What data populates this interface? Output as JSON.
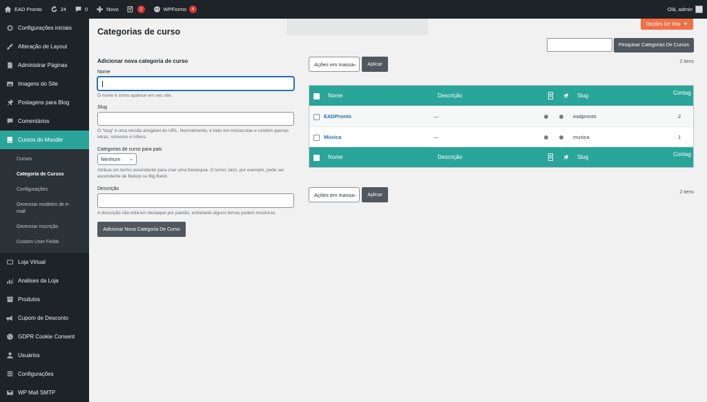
{
  "adminbar": {
    "site_name": "EAD Pronto",
    "updates_count": "24",
    "comments_count": "0",
    "new_label": "Novo",
    "yoast_badge": "2",
    "wpforms_label": "WPForms",
    "wpforms_badge": "4",
    "greeting": "Olá, admin"
  },
  "sidebar": {
    "items": [
      {
        "label": "Configurações iniciais",
        "icon": "gear-icon"
      },
      {
        "label": "Alteração de Layout",
        "icon": "brush-icon"
      },
      {
        "label": "Administrar Páginas",
        "icon": "pages-icon"
      },
      {
        "label": "Imagens do Site",
        "icon": "media-icon"
      },
      {
        "label": "Postagens para Blog",
        "icon": "pin-icon"
      },
      {
        "label": "Comentários",
        "icon": "comment-icon"
      },
      {
        "label": "Cursos do Moodle",
        "icon": "book-icon"
      }
    ],
    "submenu": [
      "Cursos",
      "Categoria de Cursos",
      "Configurações",
      "Gerenciar modelos de e-mail",
      "Gerenciar inscrição",
      "Custom User Fields"
    ],
    "items_after": [
      {
        "label": "Loja Virtual",
        "icon": "store-icon"
      },
      {
        "label": "Análises da Loja",
        "icon": "chart-icon"
      },
      {
        "label": "Produtos",
        "icon": "archive-icon"
      },
      {
        "label": "Cupom de Desconto",
        "icon": "megaphone-icon"
      },
      {
        "label": "GDPR Cookie Consent",
        "icon": "cookie-icon"
      },
      {
        "label": "Usuários",
        "icon": "user-icon"
      },
      {
        "label": "Configurações",
        "icon": "settings-icon"
      },
      {
        "label": "WP Mail SMTP",
        "icon": "mail-icon"
      }
    ]
  },
  "page": {
    "title": "Categorias de curso",
    "screen_options": "Opções De Tela",
    "search_button": "Pesquisar Categorias De Cursos"
  },
  "form": {
    "title": "Adicionar nova categoria de curso",
    "name_label": "Nome",
    "name_hint": "O nome é como aparece em seu site.",
    "slug_label": "Slug",
    "slug_hint": "O “slug” é uma versão amigável do URL. Normalmente, é todo em minúsculas e contém apenas letras, números e hífens.",
    "parent_label": "Categorias de curso para pais",
    "parent_value": "Nenhum",
    "parent_hint": "Atribua um termo ascendente para criar uma hierarquia. O termo Jazz, por exemplo, pode ser ascendente de Bebop ou Big Band.",
    "desc_label": "Descrição",
    "desc_hint": "A descrição não está em destaque por padrão, entretanto alguns temas podem mostrá-la.",
    "submit": "Adicionar Nova Categoria De Curso"
  },
  "list": {
    "bulk_actions": "Ações em massa",
    "apply": "Aplicar",
    "count": "2 itens",
    "columns": {
      "name": "Nome",
      "description": "Descrição",
      "slug": "Slug",
      "count": "Contag"
    },
    "rows": [
      {
        "name": "EADPronto",
        "description": "—",
        "slug": "eadpronto",
        "count": "2"
      },
      {
        "name": "Música",
        "description": "—",
        "slug": "musica",
        "count": "1"
      }
    ]
  }
}
